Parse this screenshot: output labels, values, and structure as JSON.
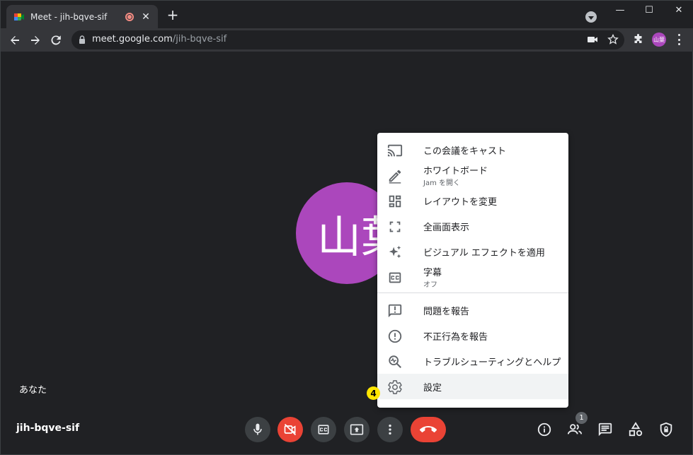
{
  "tab": {
    "title": "Meet - jih-bqve-sif",
    "close_glyph": "✕"
  },
  "newtab_glyph": "+",
  "window": {
    "minimize": "—",
    "maximize": "☐",
    "close": "✕"
  },
  "address": {
    "host": "meet.google.com",
    "path": "/jih-bqve-sif"
  },
  "profile_initials": "山葉",
  "meet": {
    "avatar_text": "山葉",
    "self_label": "あなた",
    "meeting_code": "jih-bqve-sif",
    "participants_count": "1"
  },
  "menu": {
    "items": [
      {
        "label": "この会議をキャスト",
        "icon": "cast-icon"
      },
      {
        "label": "ホワイトボード",
        "sub": "Jam を開く",
        "icon": "pencil-icon"
      },
      {
        "label": "レイアウトを変更",
        "icon": "layout-icon"
      },
      {
        "label": "全画面表示",
        "icon": "fullscreen-icon"
      },
      {
        "label": "ビジュアル エフェクトを適用",
        "icon": "sparkle-icon"
      },
      {
        "label": "字幕",
        "sub": "オフ",
        "icon": "captions-icon"
      },
      {
        "label": "問題を報告",
        "icon": "feedback-icon"
      },
      {
        "label": "不正行為を報告",
        "icon": "report-icon"
      },
      {
        "label": "トラブルシューティングとヘルプ",
        "icon": "troubleshoot-icon"
      },
      {
        "label": "設定",
        "icon": "gear-icon"
      }
    ]
  },
  "step_badge": "4",
  "colors": {
    "accent": "#ab47bc",
    "danger": "#ea4335",
    "badge": "#ffe600"
  }
}
